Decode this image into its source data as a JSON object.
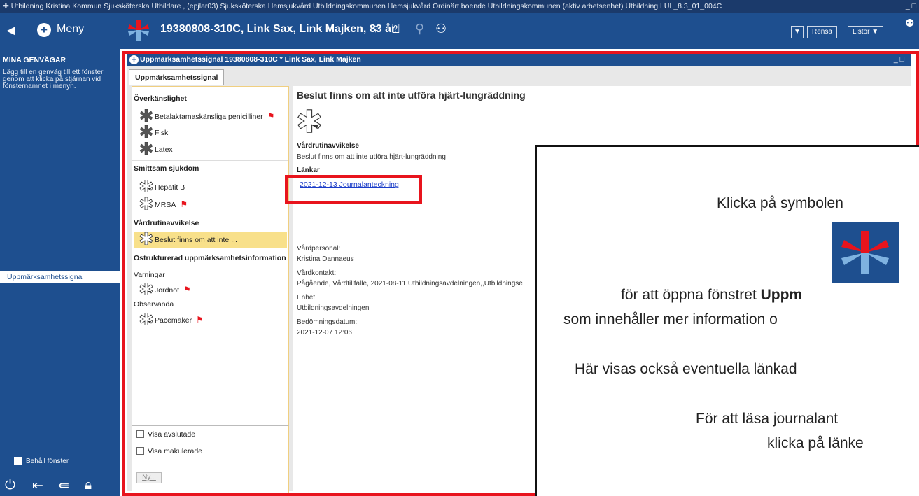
{
  "titlebar": {
    "text": "Utbildning Kristina Kommun Sjuksköterska Utbildare , (epjlar03) Sjuksköterska Hemsjukvård Utbildningskommunen Hemsjukvård Ordinärt boende Utbildningskommunen (aktiv arbetsenhet)  Utbildning LUL_8.3_01_004C",
    "controls": "_ □"
  },
  "header": {
    "first_icon": "◀",
    "menu_label": "Meny",
    "patient": "19380808-310C, Link Sax, Link Majken, 83 år",
    "rensa": "Rensa",
    "listor": "Listor ▼",
    "dropdown": "▼"
  },
  "sidebar": {
    "title": "MINA GENVÄGAR",
    "description": "Lägg till en genväg till ett fönster genom att klicka på stjärnan vid fönsternamnet i menyn.",
    "shortcut": "Uppmärksamhetssignal",
    "keep_window": "Behåll fönster"
  },
  "window": {
    "title": "Uppmärksamhetssignal 19380808-310C * Link Sax, Link Majken",
    "controls": "_ □",
    "tab": "Uppmärksamhetssignal"
  },
  "list": {
    "groups": {
      "overkanslighet": "Överkänslighet",
      "smittsam": "Smittsam sjukdom",
      "vardrutin": "Vårdrutinavvikelse",
      "ostrukturerad": "Ostrukturerad uppmärksamhetsinformation",
      "varningar": "Varningar",
      "observanda": "Observanda"
    },
    "items": {
      "betalaktam": "Betalaktamaskänsliga penicilliner",
      "fisk": "Fisk",
      "latex": "Latex",
      "hepatit": "Hepatit B",
      "mrsa": "MRSA",
      "beslut": "Beslut finns om att inte ...",
      "jordnot": "Jordnöt",
      "pacemaker": "Pacemaker"
    },
    "visa_avslutade": "Visa avslutade",
    "visa_makulerade": "Visa makulerade",
    "ny": "Ny..."
  },
  "detail": {
    "title": "Beslut finns om att inte utföra hjärt-lungräddning",
    "type_label": "Vårdrutinavvikelse",
    "type_value": "Beslut finns om att inte utföra hjärt-lungräddning",
    "links_label": "Länkar",
    "link": "2021-12-13 Journalanteckning",
    "vardpersonal_label": "Vårdpersonal:",
    "vardpersonal": "Kristina Dannaeus",
    "vardkontakt_label": "Vårdkontakt:",
    "vardkontakt": "Pågående, Vårdtillfälle, 2021-08-11,Utbildningsavdelningen,,Utbildningse",
    "enhet_label": "Enhet:",
    "enhet": "Utbildningsavdelningen",
    "bedomning_label": "Bedömningsdatum:",
    "bedomning": "2021-12-07 12:06"
  },
  "overlay": {
    "line1": "Klicka på symbolen",
    "line2_pre": "för att öppna fönstret ",
    "line2_bold": "Uppm",
    "line3": "som innehåller mer information o",
    "line4": "Här visas också eventuella länkad",
    "line5": "För att läsa journalant",
    "line6": "klicka på länke"
  },
  "colors": {
    "header_blue": "#1e4f8f",
    "highlight_red": "#e8141d",
    "selected_yellow": "#f8e08a",
    "link_blue": "#1a3cc8"
  }
}
